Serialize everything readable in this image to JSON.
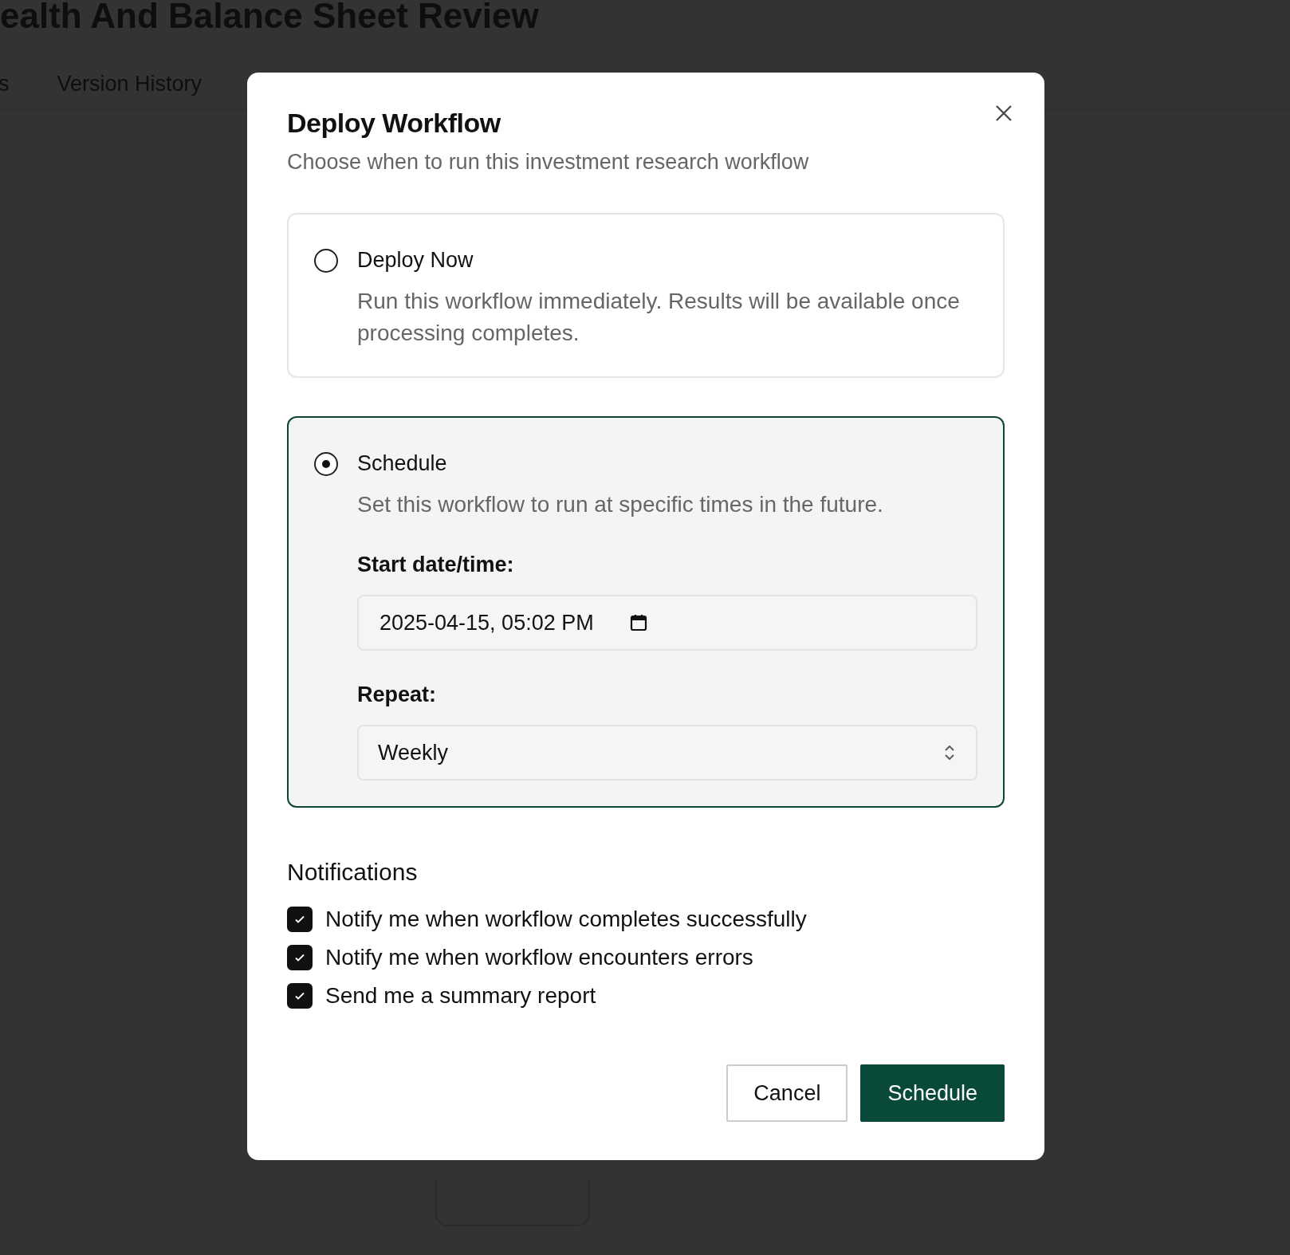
{
  "page": {
    "title": "ealth And Balance Sheet Review",
    "tabs": [
      {
        "label": "s"
      },
      {
        "label": "Version History"
      }
    ]
  },
  "dialog": {
    "title": "Deploy Workflow",
    "subtitle": "Choose when to run this investment research workflow",
    "options": [
      {
        "label": "Deploy Now",
        "description": "Run this workflow immediately. Results will be available once processing completes.",
        "selected": false
      },
      {
        "label": "Schedule",
        "description": "Set this workflow to run at specific times in the future.",
        "selected": true
      }
    ],
    "schedule": {
      "start_label": "Start date/time:",
      "start_value": "2025-04-15, 05:02 PM",
      "repeat_label": "Repeat:",
      "repeat_value": "Weekly"
    },
    "notifications": {
      "heading": "Notifications",
      "items": [
        {
          "label": "Notify me when workflow completes successfully",
          "checked": true
        },
        {
          "label": "Notify me when workflow encounters errors",
          "checked": true
        },
        {
          "label": "Send me a summary report",
          "checked": true
        }
      ]
    },
    "buttons": [
      {
        "label": "Cancel",
        "kind": "secondary"
      },
      {
        "label": "Schedule",
        "kind": "primary"
      }
    ]
  }
}
